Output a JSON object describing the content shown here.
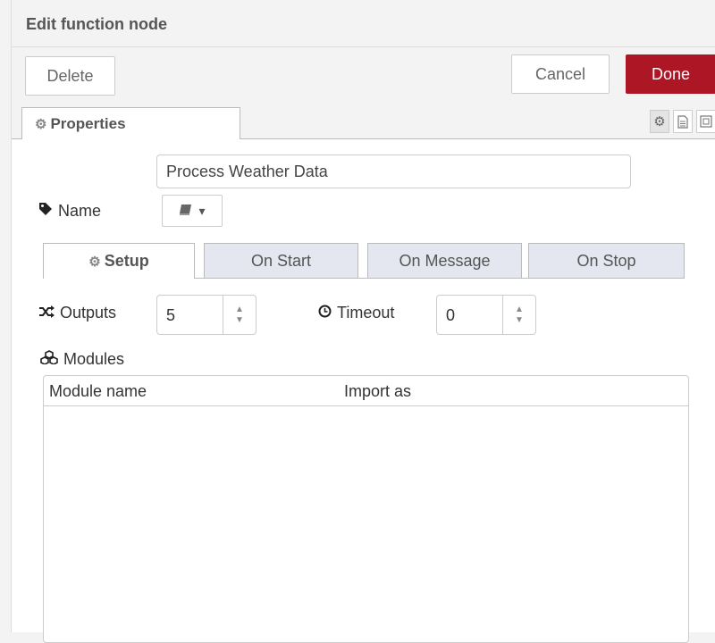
{
  "title": "Edit function node",
  "toolbar": {
    "delete_label": "Delete",
    "cancel_label": "Cancel",
    "done_label": "Done"
  },
  "tabs": {
    "properties_label": "Properties",
    "side_icons": [
      "gear-icon",
      "document-icon",
      "layout-icon"
    ]
  },
  "name": {
    "label": "Name",
    "value": "Process Weather Data"
  },
  "subtabs": [
    {
      "label": "Setup",
      "active": true
    },
    {
      "label": "On Start",
      "active": false
    },
    {
      "label": "On Message",
      "active": false
    },
    {
      "label": "On Stop",
      "active": false
    }
  ],
  "outputs": {
    "label": "Outputs",
    "value": "5"
  },
  "timeout": {
    "label": "Timeout",
    "value": "0"
  },
  "modules": {
    "label": "Modules",
    "columns": [
      "Module name",
      "Import as"
    ],
    "rows": []
  },
  "colors": {
    "done_button": "#ad1625",
    "inactive_tab": "#e5e7f0"
  }
}
